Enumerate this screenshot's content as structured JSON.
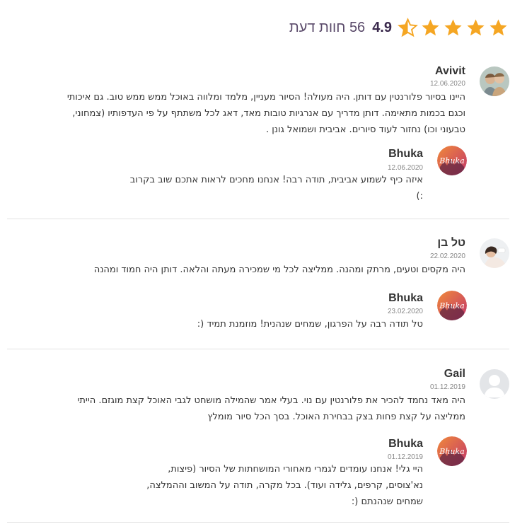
{
  "header": {
    "rating_score": "4.9",
    "review_count_label": "56 חוות דעת",
    "stars": [
      1,
      1,
      1,
      1,
      0.5
    ],
    "star_color": "#f5a623",
    "star_empty_color": "#ffffff"
  },
  "reviews": [
    {
      "name": "Avivit",
      "date": "12.06.2020",
      "text": "היינו בסיור פלורנטין עם דותן. היה מעולה! הסיור מעניין, מלמד ומלווה באוכל ממש ממש טוב. גם איכותי\nוכגם בכמות מתאימה. דותן מדריך עם אנרגיות טובות מאד, דאג לכל משתתף על פי העדפותיו (צמחוני,\nטבעוני וכו) נחזור לעוד סיורים. אביבית ושמואל גונן .",
      "avatar_icon": "user-photo-icon",
      "reply": {
        "name": "Bhuka",
        "date": "12.06.2020",
        "text": "איזה כיף לשמוע אביבית, תודה רבה! אנחנו מחכים לראות אתכם שוב בקרוב\n:)",
        "avatar_label": "Bhuka"
      }
    },
    {
      "name": "טל בן",
      "date": "22.02.2020",
      "text": "היה מקסים וטעים, מרתק ומהנה. ממליצה לכל מי שמכירה מעתה והלאה. דותן היה חמוד ומהנה",
      "avatar_icon": "user-photo-icon",
      "reply": {
        "name": "Bhuka",
        "date": "23.02.2020",
        "text": "טל תודה רבה על הפרגון, שמחים שנהנית! מוזמנת תמיד (:",
        "avatar_label": "Bhuka"
      }
    },
    {
      "name": "Gail",
      "date": "01.12.2019",
      "text": "היה מאד נחמד להכיר את פלורנטין עם נוי. בעלי אמר שהמילה מושחט לגבי האוכל קצת מוגזם. הייתי\nממליצה על קצת פחות בצק בבחירת האוכל. בסך הכל סיור מומלץ",
      "avatar_icon": "default-user-icon",
      "reply": {
        "name": "Bhuka",
        "date": "01.12.2019",
        "text": "היי גלי! אנחנו עומדים לגמרי מאחורי המושחתות של הסיור (פיצות,\nנא'צוסים, קרפים, גלידה ועוד). בכל מקרה, תודה על המשוב וההמלצה,\nשמחים שנהנתם (:",
        "avatar_label": "Bhuka"
      }
    }
  ]
}
